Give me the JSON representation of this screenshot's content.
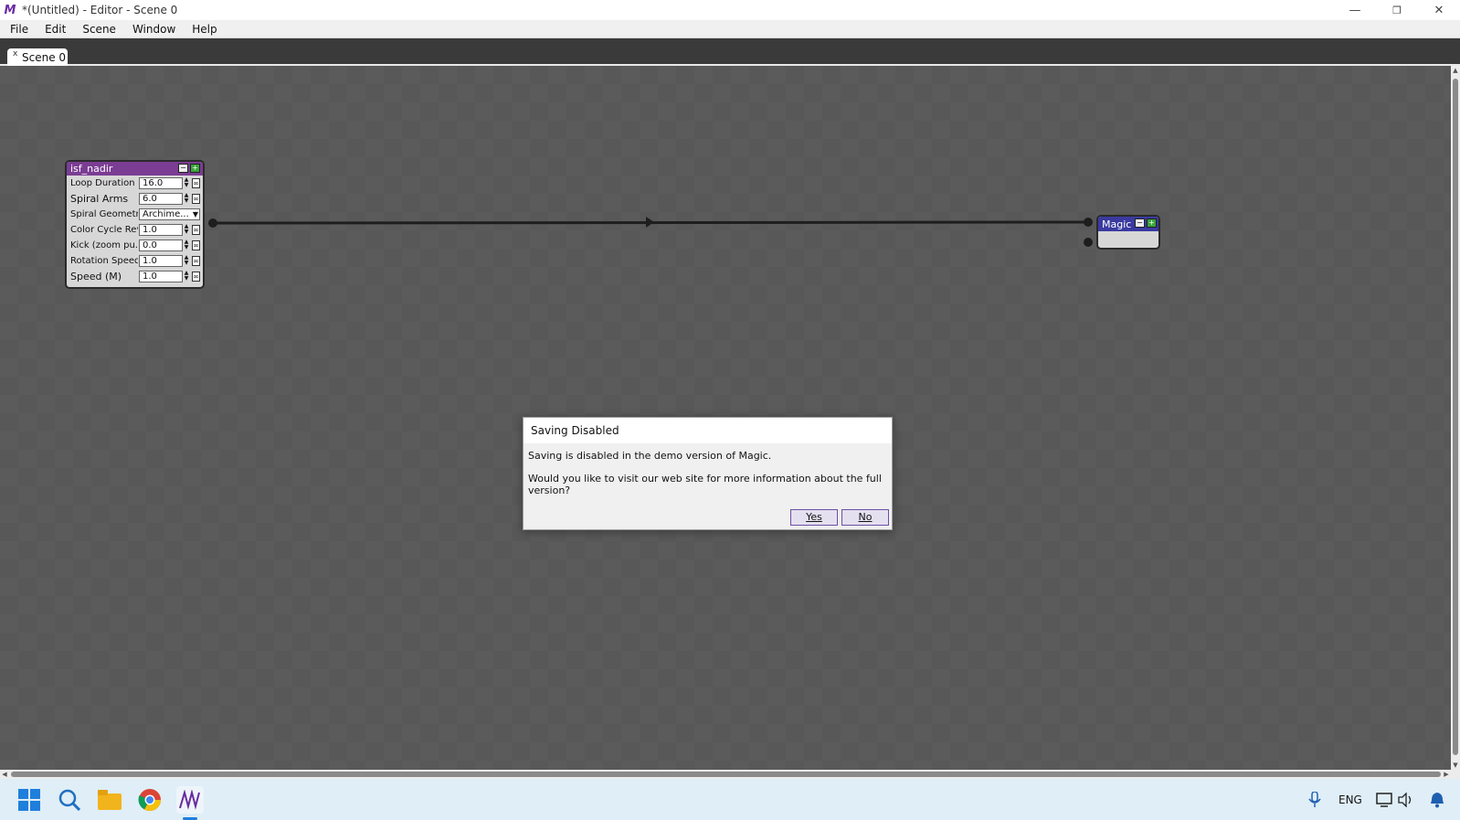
{
  "window": {
    "title": "*(Untitled) - Editor - Scene 0",
    "logo": "M",
    "minimize": "—",
    "maximize": "❐",
    "close": "✕"
  },
  "menu": [
    "File",
    "Edit",
    "Scene",
    "Window",
    "Help"
  ],
  "tab": {
    "label": "Scene 0",
    "close": "x"
  },
  "node_isf": {
    "title": "isf_nadir",
    "params": [
      {
        "label": "Loop Duration (s)",
        "value": "16.0"
      },
      {
        "label": "Spiral Arms",
        "value": "6.0"
      },
      {
        "label": "Spiral Geometry",
        "value": "Archime..."
      },
      {
        "label": "Color Cycle Revs",
        "value": "1.0"
      },
      {
        "label": "Kick (zoom pu...",
        "value": "0.0"
      },
      {
        "label": "Rotation Speed",
        "value": "1.0"
      },
      {
        "label": "Speed (M)",
        "value": "1.0"
      }
    ]
  },
  "node_magic": {
    "title": "Magic"
  },
  "dialog": {
    "title": "Saving Disabled",
    "message1": "Saving is disabled in the demo version of Magic.",
    "message2": "Would you like to visit our web site for more information about the full version?",
    "yes": "Yes",
    "no": "No"
  },
  "taskbar": {
    "language": "ENG"
  },
  "colors": {
    "isf_header": "#7b3d93",
    "magic_header": "#3a3aa0",
    "plus_green": "#3aa63a",
    "canvas": "#5b5b5b"
  }
}
